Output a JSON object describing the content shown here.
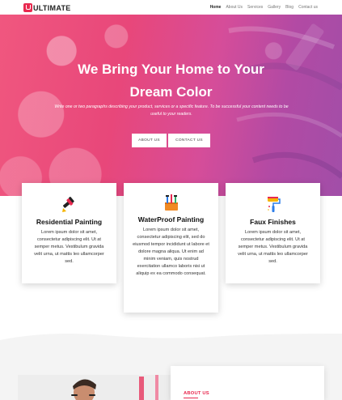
{
  "brand": {
    "logo_letter": "U",
    "name": "ULTIMATE",
    "accent": "#e8294f"
  },
  "nav": {
    "items": [
      {
        "label": "Home",
        "active": true
      },
      {
        "label": "About Us",
        "active": false
      },
      {
        "label": "Services",
        "active": false
      },
      {
        "label": "Gallery",
        "active": false
      },
      {
        "label": "Blog",
        "active": false
      },
      {
        "label": "Contact us",
        "active": false
      }
    ]
  },
  "hero": {
    "title_line1": "We Bring Your Home to Your",
    "title_line2": "Dream Color",
    "subtitle_line1": "Write one or two paragraphs describing your product, services or a specific feature.  To be successful your content needs to be",
    "subtitle_line2": "useful to your readers.",
    "buttons": {
      "about": "ABOUT US",
      "contact": "CONTACT US"
    }
  },
  "services": [
    {
      "icon": "paint-brush-icon",
      "title": "Residential Painting",
      "text": "Lorem ipsum dolor sit amet, consectetur adipiscing elit. Ut at semper metus. Vestibulum gravida velit urna, ut mattis leo ullamcorper sed."
    },
    {
      "icon": "paint-tools-icon",
      "title": "WaterProof Painting",
      "text": "Lorem ipsum dolor sit amet, consectetur adipiscing elit, sed do eiusmod tempor incididunt ut labore et dolore magna aliqua. Ut enim ad minim veniam, quis nostrud exercitation ullamco laboris nisi ut aliquip ex ea commodo consequat."
    },
    {
      "icon": "paint-roller-icon",
      "title": "Faux Finishes",
      "text": "Lorem ipsum dolor sit amet, consectetur adipiscing elit. Ut at semper metus. Vestibulum gravida velit urna, ut mattis leo ullamcorper sed."
    }
  ],
  "about": {
    "label": "ABOUT US"
  }
}
